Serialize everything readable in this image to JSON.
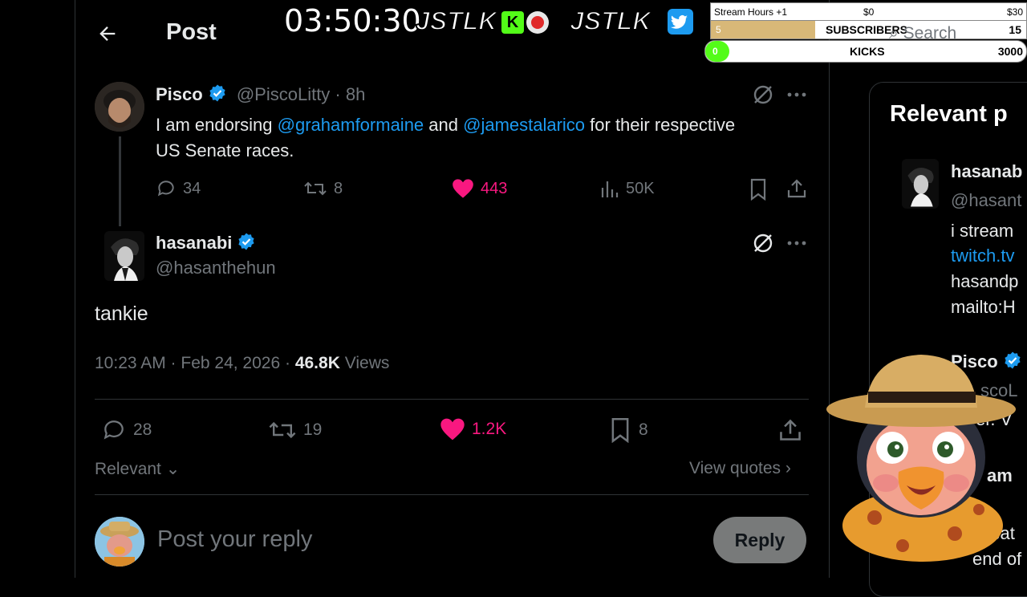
{
  "header": {
    "title": "Post",
    "search_placeholder": "Search"
  },
  "parent_post": {
    "name": "Pisco",
    "handle": "@PiscoLitty",
    "time": "8h",
    "text_before": "I am endorsing ",
    "mention1": "@grahamformaine",
    "text_mid": " and ",
    "mention2": "@jamestalarico",
    "text_after": " for their respective",
    "text_line2": "US Senate races.",
    "replies": "34",
    "reposts": "8",
    "likes": "443",
    "views": "50K"
  },
  "main_post": {
    "name": "hasanabi",
    "handle": "@hasanthehun",
    "text": "tankie",
    "timestamp": "10:23 AM · Feb 24, 2026 ·",
    "views_count": "46.8K",
    "views_label": "Views",
    "replies": "28",
    "reposts": "19",
    "likes": "1.2K",
    "bookmarks": "8"
  },
  "sort": {
    "label": "Relevant",
    "view_quotes": "View quotes"
  },
  "reply_box": {
    "placeholder": "Post your reply",
    "button": "Reply"
  },
  "sidebar": {
    "title": "Relevant p",
    "person1": {
      "name": "hasanab",
      "handle": "@hasant",
      "bio_line1": "i stream",
      "bio_link": "twitch.tv",
      "bio_line3": "hasandp",
      "bio_line4": "mailto:H"
    },
    "person2": {
      "name": "Pisco",
      "handle": "scoL",
      "bio_frag": "er. V",
      "name2_frag": "am",
      "bio_frag2": "nbat",
      "bio_frag3": "end of"
    }
  },
  "stream_overlay": {
    "timer": "03:50:30",
    "brand1": "JSTLK",
    "brand2": "JSTLK",
    "stream_hours_label": "Stream Hours +1",
    "goal_start": "$0",
    "goal_end": "$30",
    "subs_current": "5",
    "subs_label": "SUBSCRIBERS",
    "subs_goal": "15",
    "kicks_current": "0",
    "kicks_label": "KICKS",
    "kicks_goal": "3000"
  },
  "colors": {
    "accent_blue": "#1d9bf0",
    "like_pink": "#f91880",
    "kick_green": "#53fc18",
    "subs_fill": "#d8b878"
  }
}
